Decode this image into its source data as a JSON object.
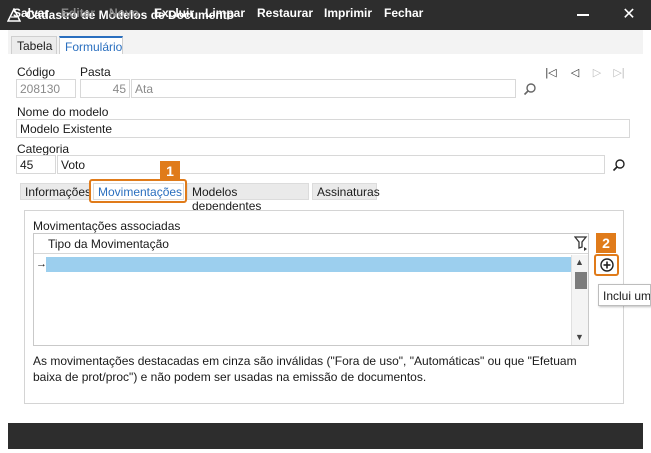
{
  "window": {
    "title": "Cadastro de Modelos de Documento",
    "close_glyph": "✕"
  },
  "tabs": {
    "tabela": "Tabela",
    "formulario": "Formulário"
  },
  "form": {
    "codigo_label": "Código",
    "codigo_value": "208130",
    "pasta_label": "Pasta",
    "pasta_number": "45",
    "pasta_name": "Ata",
    "nome_label": "Nome do modelo",
    "nome_value": "Modelo Existente",
    "categoria_label": "Categoria",
    "categoria_number": "45",
    "categoria_name": "Voto"
  },
  "nav": {
    "first": "|◁",
    "prev": "◁",
    "next": "▷",
    "last": "▷|"
  },
  "subtabs": [
    "Informações",
    "Movimentações",
    "Modelos dependentes",
    "Assinaturas"
  ],
  "group": {
    "title": "Movimentações associadas",
    "column_header": "Tipo da Movimentação",
    "row_indicator": "→",
    "note": "As movimentações destacadas em cinza são inválidas (\"Fora de uso\", \"Automáticas\" ou que \"Efetuam baixa de prot/proc\") e não podem ser usadas na emissão de documentos."
  },
  "tooltip": "Inclui um",
  "badges": {
    "one": "1",
    "two": "2"
  },
  "toolbar": [
    "Salvar",
    "Editar",
    "Novo",
    "Excluir",
    "Limpar",
    "Restaurar",
    "Imprimir",
    "Fechar"
  ],
  "toolbar_disabled": [
    "Editar",
    "Novo"
  ],
  "icons": [
    "app-logo-icon",
    "minimize-icon",
    "close-icon",
    "search-icon",
    "filter-icon",
    "add-circle-icon"
  ],
  "colors": {
    "titlebar": "#2d2d2d",
    "accent_orange": "#e07b1a",
    "selection": "#9ccfee",
    "tab_blue": "#2a6fbf"
  }
}
